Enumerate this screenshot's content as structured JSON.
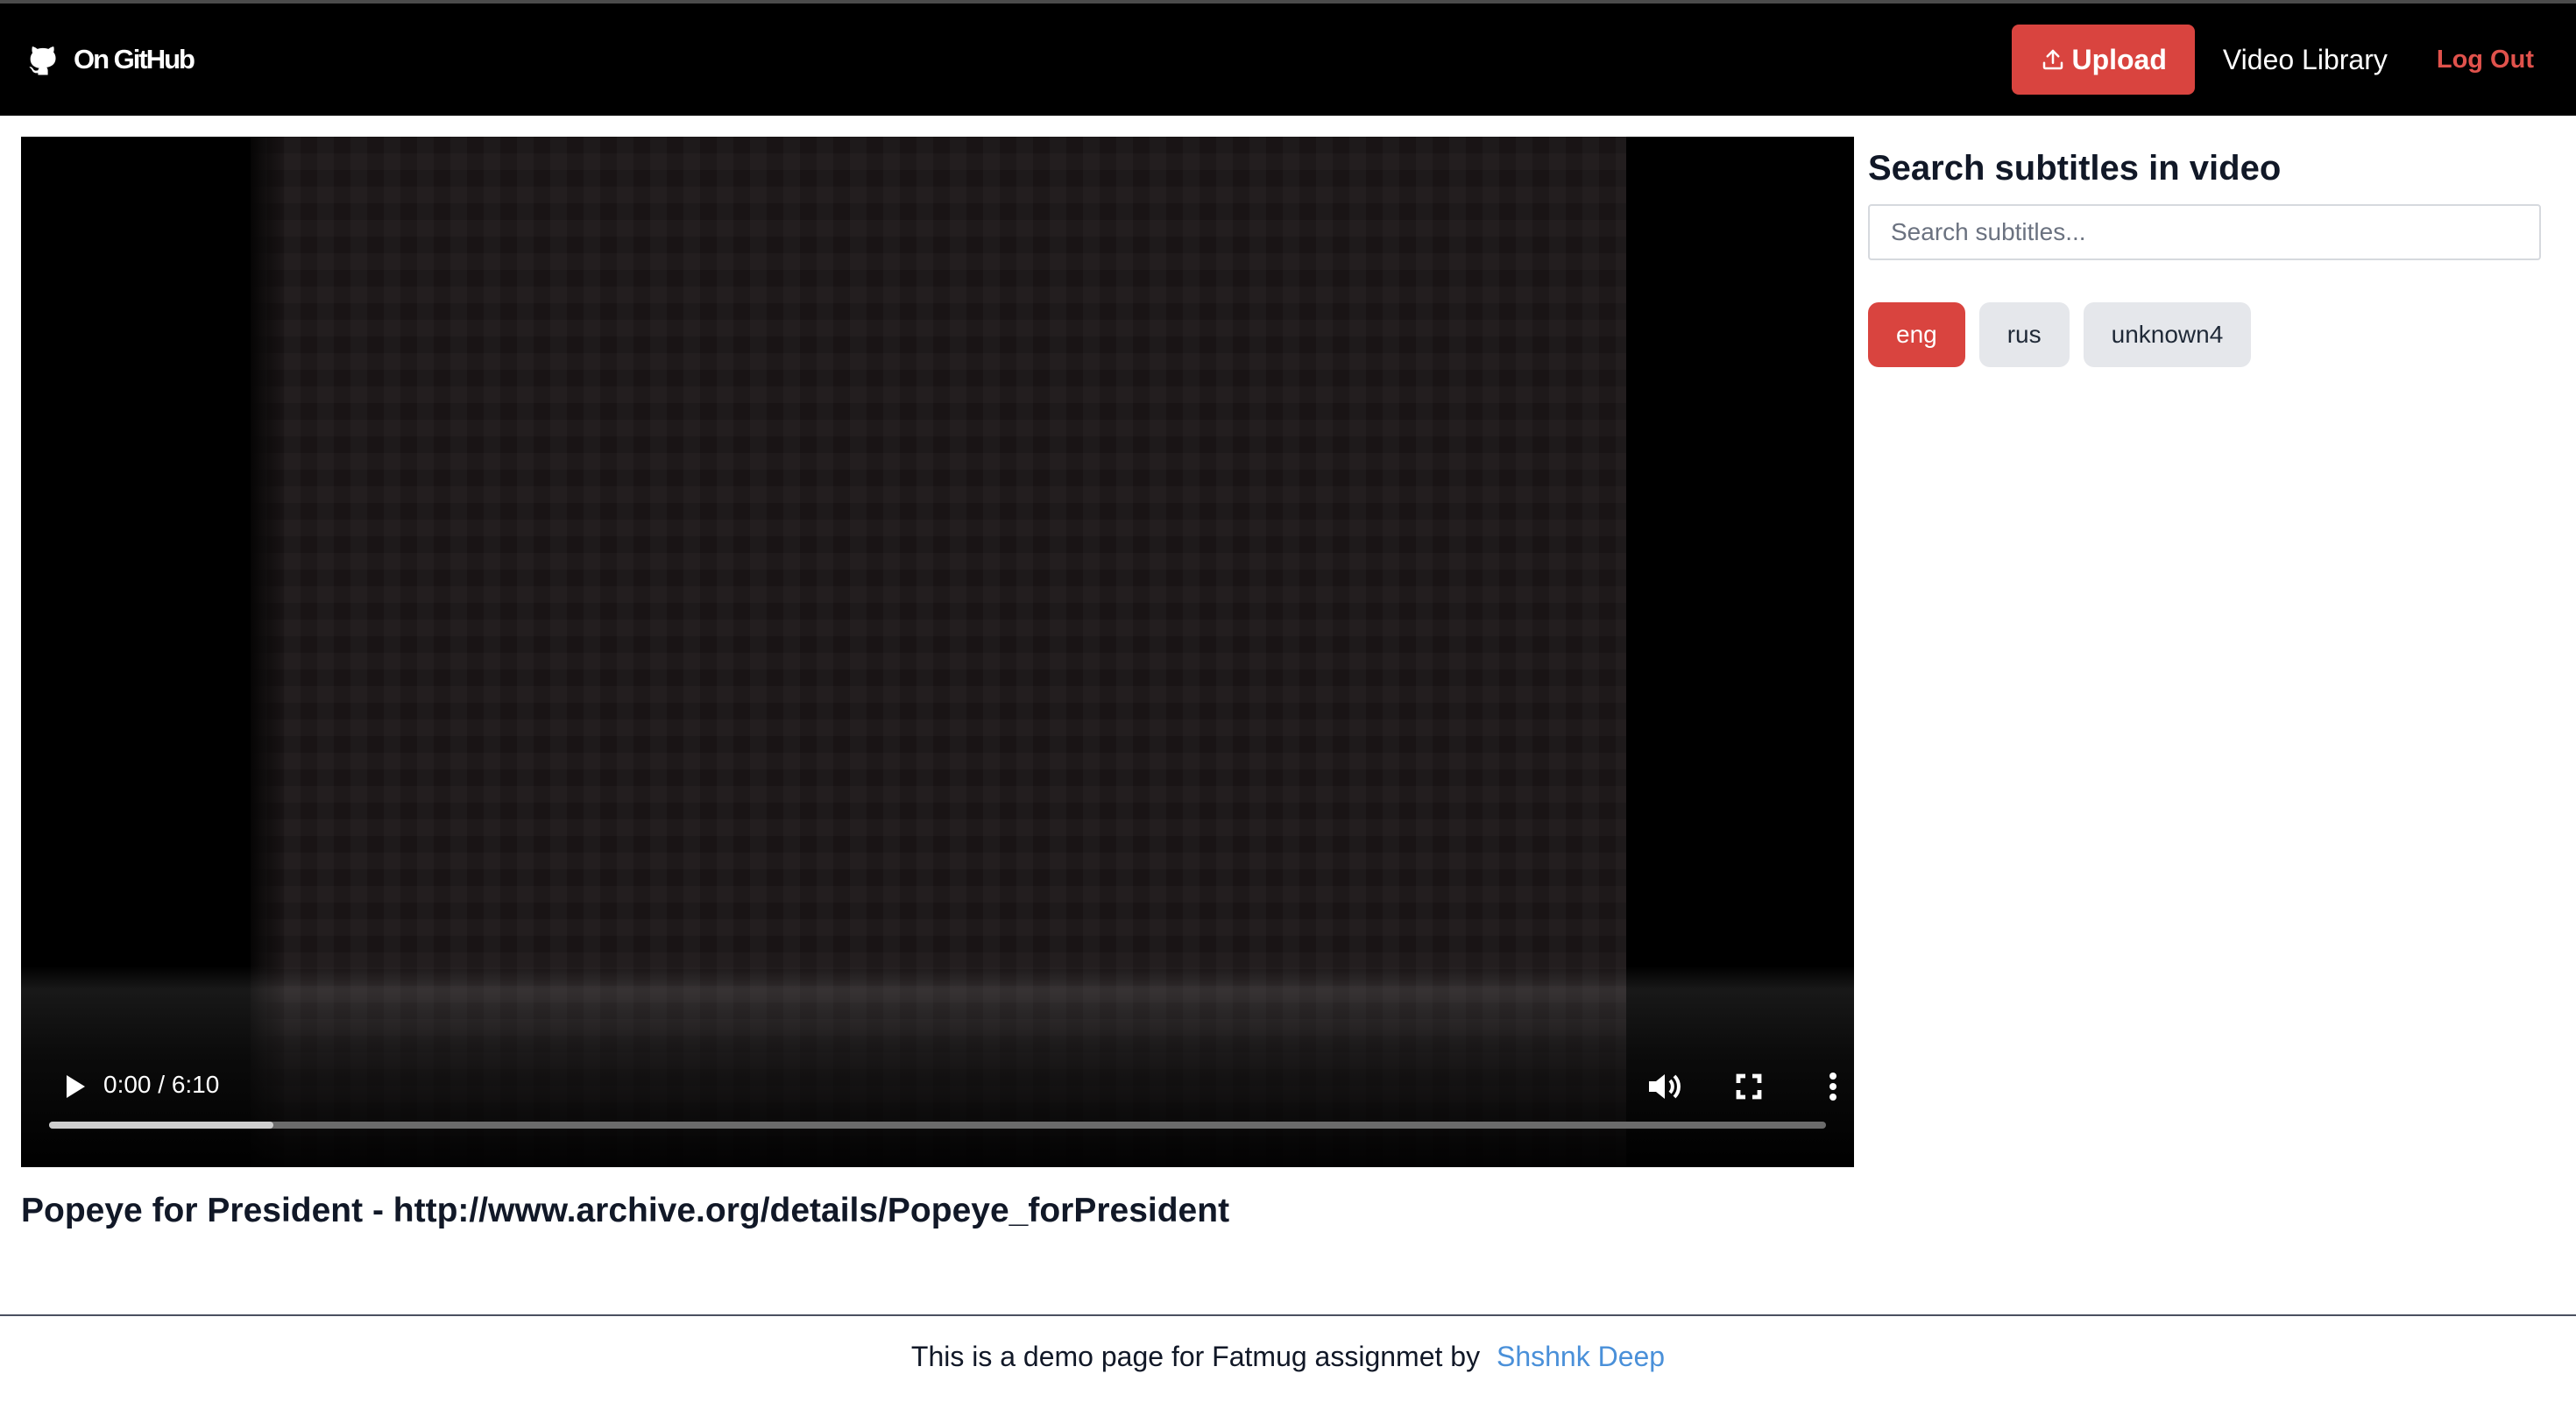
{
  "navbar": {
    "brand_label": "On GitHub",
    "upload_label": "Upload",
    "library_label": "Video Library",
    "logout_label": "Log Out"
  },
  "player": {
    "time_display": "0:00 / 6:10",
    "buffered_fraction": 0.126
  },
  "video": {
    "title": "Popeye for President - http://www.archive.org/details/Popeye_forPresident"
  },
  "sidebar": {
    "heading": "Search subtitles in video",
    "search_placeholder": "Search subtitles...",
    "languages": [
      {
        "label": "eng",
        "active": true
      },
      {
        "label": "rus",
        "active": false
      },
      {
        "label": "unknown4",
        "active": false
      }
    ]
  },
  "footer": {
    "text": "This is a demo page for Fatmug assignmet by",
    "link_label": "Shshnk Deep"
  },
  "colors": {
    "accent": "#d9443f",
    "navbar_bg": "#000000",
    "link": "#4a90d9"
  }
}
